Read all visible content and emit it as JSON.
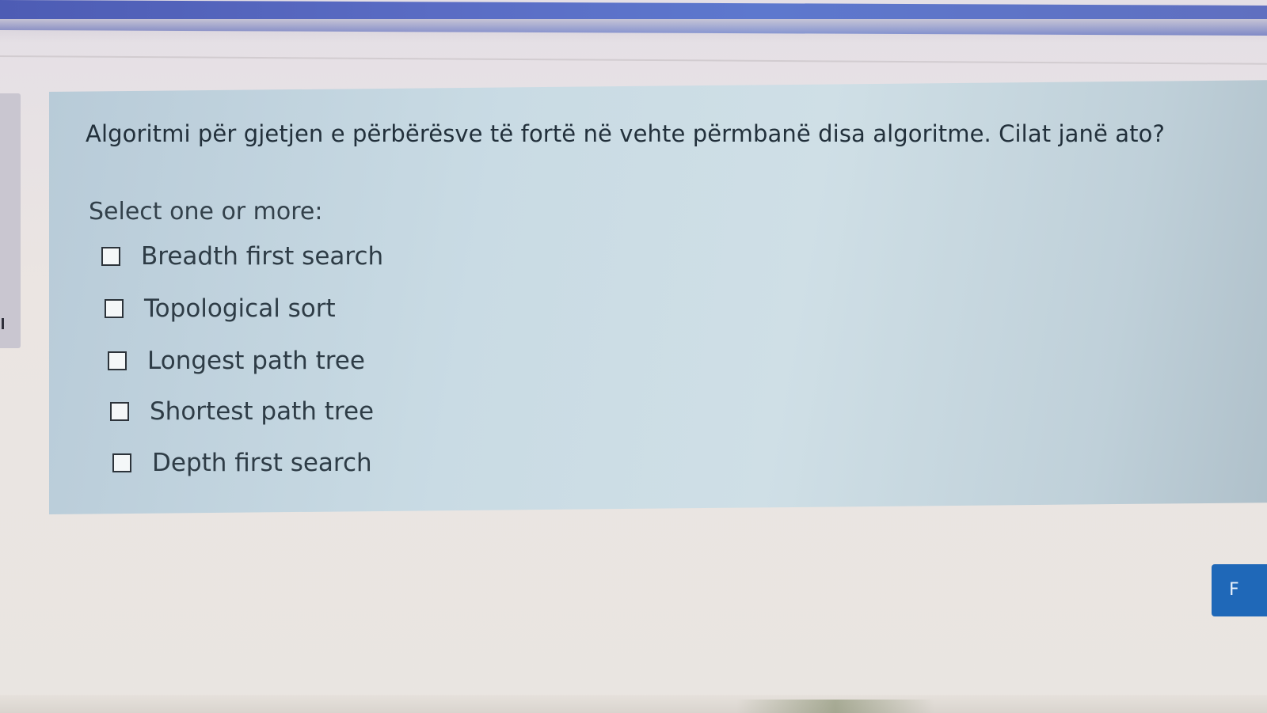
{
  "question": {
    "text": "Algoritmi për gjetjen e përbërësve të fortë në vehte përmbanë disa algoritme. Cilat janë ato?",
    "prompt": "Select one or more:",
    "options": [
      {
        "label": "Breadth first search",
        "checked": false
      },
      {
        "label": "Topological sort",
        "checked": false
      },
      {
        "label": "Longest path tree",
        "checked": false
      },
      {
        "label": "Shortest path tree",
        "checked": false
      },
      {
        "label": "Depth first search",
        "checked": false
      }
    ]
  },
  "navigation": {
    "next_button_label": "F"
  },
  "colors": {
    "header_bar": "#5a6cc4",
    "question_panel": "#c9dbe4",
    "next_button": "#1f68b8",
    "checkbox_border": "#2c333a"
  }
}
